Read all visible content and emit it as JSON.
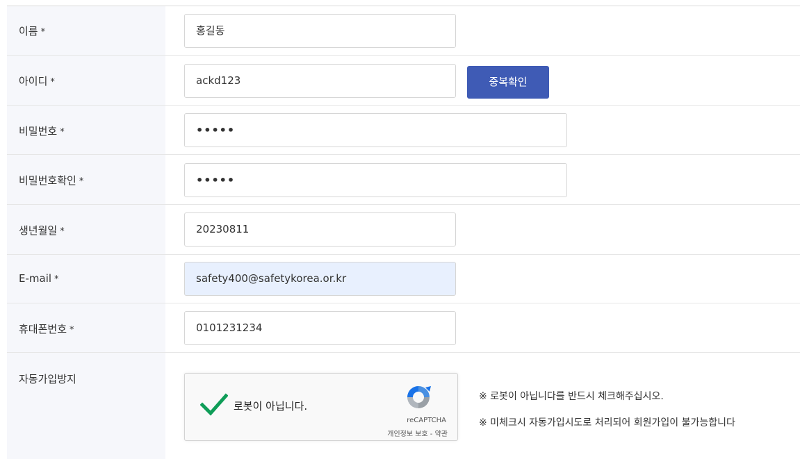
{
  "form": {
    "required_mark": "*",
    "rows": [
      {
        "label": "이름",
        "value": "홍길동"
      },
      {
        "label": "아이디",
        "value": "ackd123"
      },
      {
        "label": "비밀번호",
        "value": "•••••"
      },
      {
        "label": "비밀번호확인",
        "value": "•••••"
      },
      {
        "label": "생년월일",
        "value": "20230811"
      },
      {
        "label": "E-mail",
        "value": "safety400@safetykorea.or.kr"
      },
      {
        "label": "휴대폰번호",
        "value": "0101231234"
      },
      {
        "label": "자동가입방지"
      }
    ],
    "dup_check_button": "중복확인"
  },
  "captcha": {
    "label": "로봇이 아닙니다.",
    "brand": "reCAPTCHA",
    "terms": "개인정보 보호 - 약관",
    "checked": true
  },
  "notices": [
    "※ 로봇이 아닙니다를 반드시 체크해주십시오.",
    "※ 미체크시 자동가입시도로 처리되어 회원가입이 불가능합니다"
  ],
  "colors": {
    "button_bg": "#3f5bb5",
    "label_col_bg": "#f6f7fb",
    "autofill_bg": "#e8f0fe",
    "check_green": "#0f9d58"
  },
  "icons": {
    "checkmark": "checkmark-icon",
    "recaptcha": "recaptcha-logo-icon"
  }
}
